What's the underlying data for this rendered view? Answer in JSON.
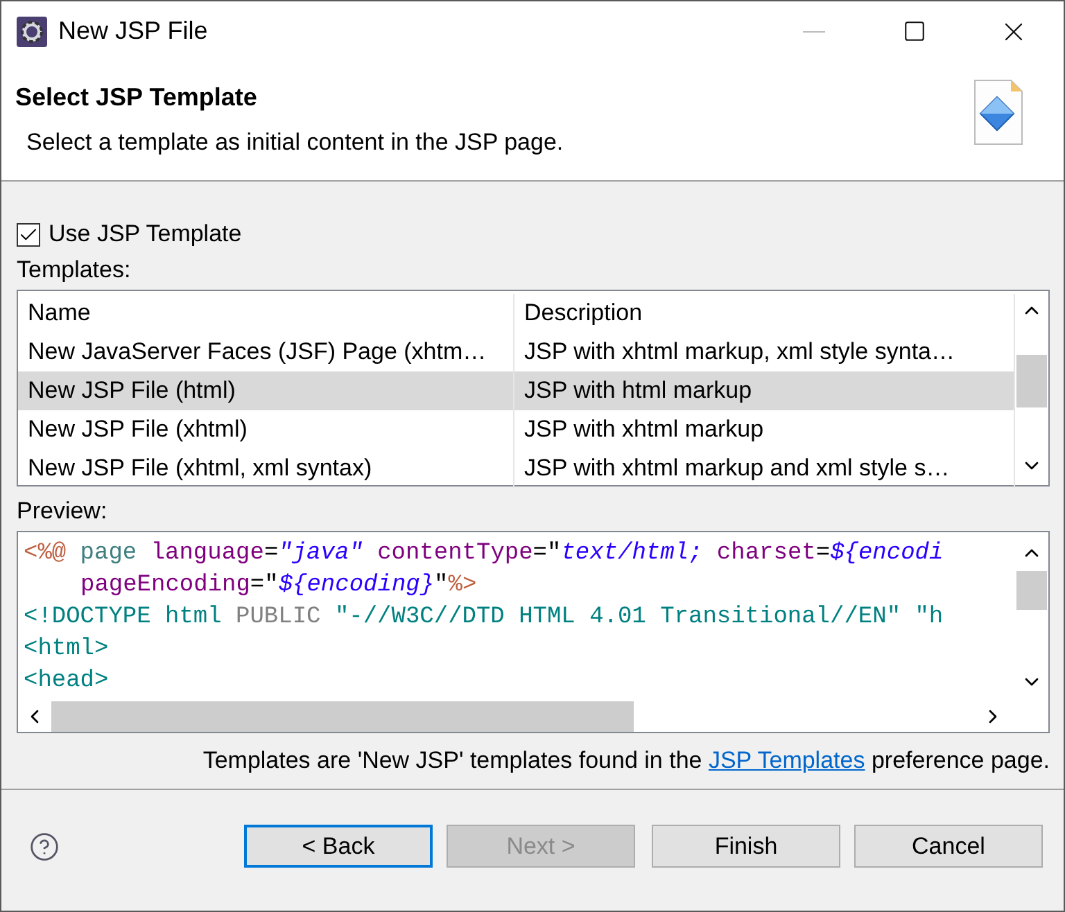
{
  "window": {
    "title": "New JSP File"
  },
  "header": {
    "title": "Select JSP Template",
    "description": "Select a template as initial content in the JSP page."
  },
  "use_template": {
    "label": "Use JSP Template",
    "checked": true
  },
  "templates": {
    "label": "Templates:",
    "columns": [
      "Name",
      "Description"
    ],
    "rows": [
      {
        "name": "New JavaServer Faces (JSF) Page (xhtm…",
        "description": "JSP with xhtml markup, xml style synta…",
        "selected": false
      },
      {
        "name": "New JSP File (html)",
        "description": "JSP with html markup",
        "selected": true
      },
      {
        "name": "New JSP File (xhtml)",
        "description": "JSP with xhtml markup",
        "selected": false
      },
      {
        "name": "New JSP File (xhtml, xml syntax)",
        "description": "JSP with xhtml markup and xml style s…",
        "selected": false
      }
    ]
  },
  "preview": {
    "label": "Preview:",
    "lines": [
      {
        "indent": false,
        "tokens": [
          {
            "kind": "delimiter",
            "text": "<%@"
          },
          {
            "kind": "directive",
            "text": " page"
          },
          {
            "kind": "attribute",
            "text": " language"
          },
          {
            "kind": "plain",
            "text": "="
          },
          {
            "kind": "value",
            "text": "\"java\""
          },
          {
            "kind": "attribute",
            "text": " contentType"
          },
          {
            "kind": "plain",
            "text": "=\""
          },
          {
            "kind": "value",
            "text": "text/html;"
          },
          {
            "kind": "attribute",
            "text": " charset"
          },
          {
            "kind": "plain",
            "text": "="
          },
          {
            "kind": "value",
            "text": "${encodi"
          }
        ]
      },
      {
        "indent": true,
        "tokens": [
          {
            "kind": "attribute",
            "text": "pageEncoding"
          },
          {
            "kind": "plain",
            "text": "=\""
          },
          {
            "kind": "value",
            "text": "${encoding}"
          },
          {
            "kind": "plain",
            "text": "\""
          },
          {
            "kind": "delimiter",
            "text": "%>"
          }
        ]
      },
      {
        "indent": false,
        "tokens": [
          {
            "kind": "tag",
            "text": "<!DOCTYPE html"
          },
          {
            "kind": "keyword",
            "text": " PUBLIC"
          },
          {
            "kind": "tag",
            "text": " \"-//W3C//DTD HTML 4.01 Transitional//EN\" \"h"
          }
        ]
      },
      {
        "indent": false,
        "tokens": [
          {
            "kind": "tag",
            "text": "<html>"
          }
        ]
      },
      {
        "indent": false,
        "tokens": [
          {
            "kind": "tag",
            "text": "<head>"
          }
        ]
      }
    ]
  },
  "footnote": {
    "before": "Templates are 'New JSP' templates found in the ",
    "link": "JSP Templates",
    "after": " preference page."
  },
  "buttons": [
    {
      "label": "< Back",
      "disabled": false,
      "focused": true
    },
    {
      "label": "Next >",
      "disabled": true,
      "focused": false
    },
    {
      "label": "Finish",
      "disabled": false,
      "focused": false
    },
    {
      "label": "Cancel",
      "disabled": false,
      "focused": false
    }
  ]
}
